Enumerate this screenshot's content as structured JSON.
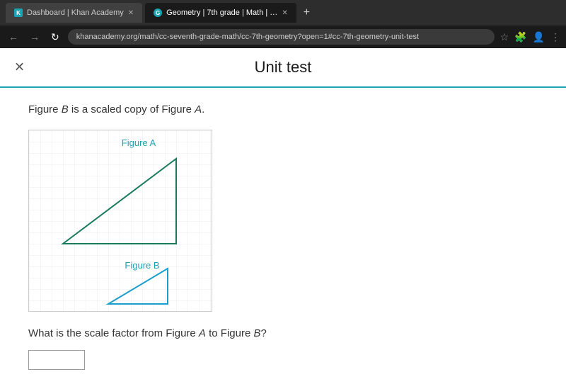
{
  "browser": {
    "tabs": [
      {
        "label": "Dashboard | Khan Academy",
        "favicon": "K",
        "active": false
      },
      {
        "label": "Geometry | 7th grade | Math | …",
        "favicon": "G",
        "active": true
      }
    ],
    "new_tab": "+",
    "address": "khanacademy.org/math/cc-seventh-grade-math/cc-7th-geometry?open=1#cc-7th-geometry-unit-test",
    "back": "←",
    "forward": "→",
    "reload": "↻"
  },
  "page": {
    "title": "Unit test",
    "close_icon": "✕"
  },
  "problem": {
    "description": "Figure B is a scaled copy of Figure A.",
    "figure_a_label": "Figure A",
    "figure_b_label": "Figure B",
    "question": "What is the scale factor from Figure A to Figure B?",
    "answer_placeholder": ""
  }
}
